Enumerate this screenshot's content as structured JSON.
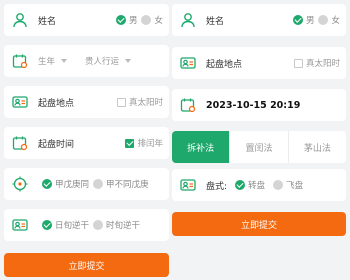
{
  "left": {
    "name_label": "姓名",
    "gender_male": "男",
    "gender_female": "女",
    "birth_select": "生年",
    "year_select": "贵人行运",
    "place_label": "起盘地点",
    "true_solar": "真太阳时",
    "time_label": "起盘时间",
    "leap_year": "排闰年",
    "wuxu_opt1": "甲戊庚同",
    "wuxu_opt2": "甲不同戊庚",
    "day_opt1": "日旬逆干",
    "day_opt2": "时旬逆干",
    "submit": "立即提交"
  },
  "right": {
    "name_label": "姓名",
    "gender_male": "男",
    "gender_female": "女",
    "place_label": "起盘地点",
    "true_solar": "真太阳时",
    "datetime": "2023-10-15 20:19",
    "tabs": [
      "拆补法",
      "置闰法",
      "茅山法"
    ],
    "pan_label": "盘式:",
    "pan_opt1": "转盘",
    "pan_opt2": "飞盘",
    "submit": "立即提交"
  },
  "colors": {
    "accent": "#1ea86b",
    "button": "#f46a11"
  }
}
